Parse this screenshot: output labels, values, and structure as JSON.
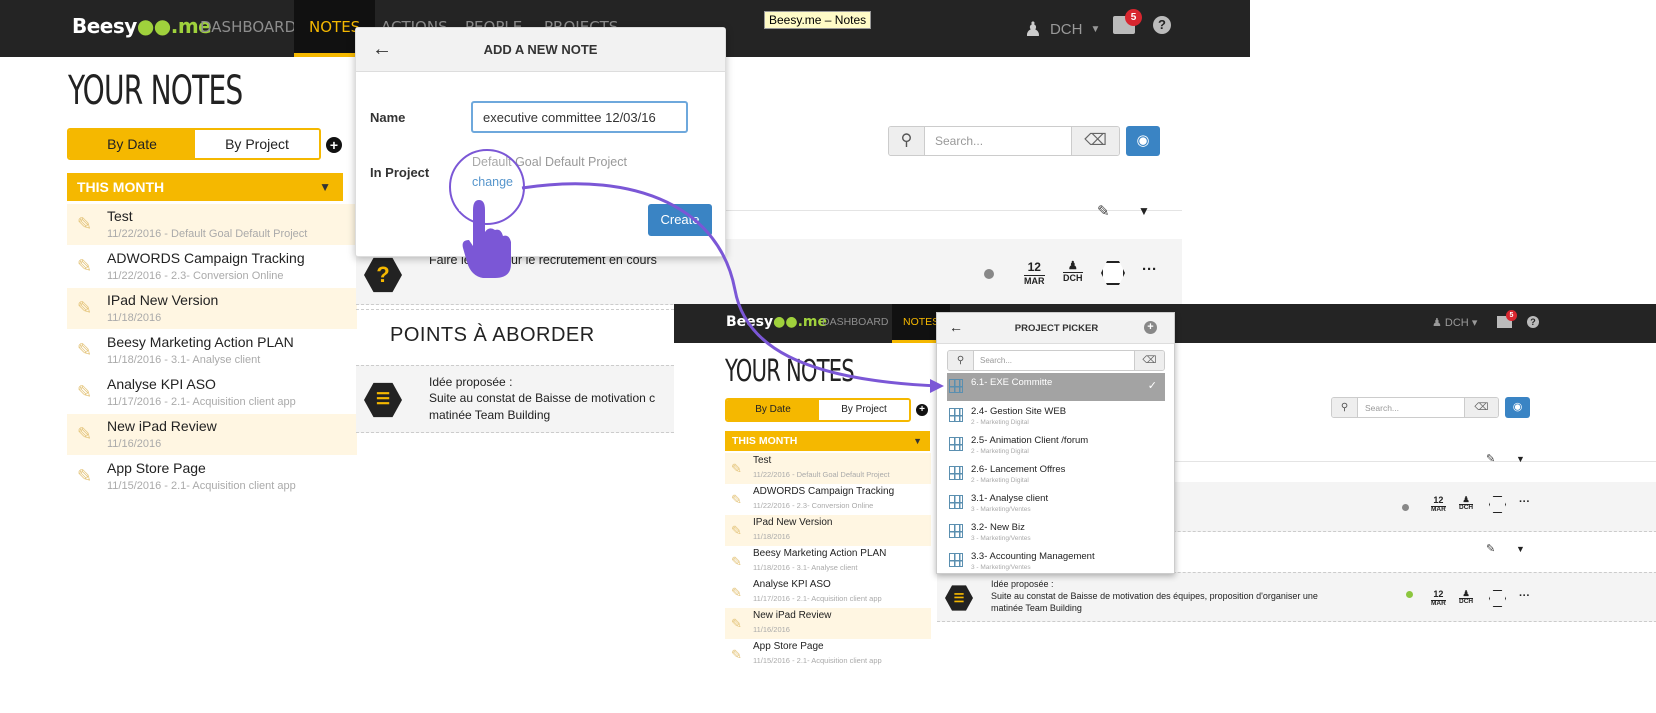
{
  "tooltip": "Beesy.me – Notes",
  "nav": {
    "logo_a": "Beesy",
    "logo_dots": "●●",
    "logo_b": ".me",
    "items": [
      "DASHBOARD",
      "NOTES",
      "ACTIONS",
      "PEOPLE",
      "PROJECTS"
    ],
    "user": "DCH",
    "badge": "5"
  },
  "page_title": "YOUR NOTES",
  "tabs": {
    "by_date": "By Date",
    "by_project": "By Project"
  },
  "month_label": "THIS MONTH",
  "notes": [
    {
      "title": "Test",
      "sub": "11/22/2016  -  Default Goal Default Project"
    },
    {
      "title": "ADWORDS Campaign Tracking",
      "sub": "11/22/2016  -  2.3- Conversion Online"
    },
    {
      "title": "IPad New Version",
      "sub": "11/18/2016"
    },
    {
      "title": "Beesy Marketing Action PLAN",
      "sub": "11/18/2016  -  3.1- Analyse client"
    },
    {
      "title": "Analyse KPI ASO",
      "sub": "11/17/2016  -  2.1- Acquisition client app"
    },
    {
      "title": "New iPad Review",
      "sub": "11/16/2016"
    },
    {
      "title": "App Store Page",
      "sub": "11/15/2016  -  2.1- Acquisition client app"
    }
  ],
  "search_placeholder": "Search...",
  "modal": {
    "title": "ADD A NEW NOTE",
    "name_label": "Name",
    "name_value": "executive committee 12/03/16",
    "project_label": "In Project",
    "project_value": "Default Goal Default Project",
    "change_link": "change",
    "create_button": "Create"
  },
  "row1": {
    "text": "Faire le point sur le recrutement en cours",
    "day": "12",
    "month": "MAR",
    "owner": "DCH",
    "icon": "?"
  },
  "section_title": "POINTS À ABORDER",
  "row2": {
    "label": "Idée proposée :",
    "text": "Suite au constat de Baisse de motivation des équipes, proposition d'organiser une matinée Team Building",
    "text_cut": "Suite au constat de Baisse de motivation c",
    "text_line2": "matinée Team Building"
  },
  "picker": {
    "title": "PROJECT PICKER",
    "search_placeholder": "Search...",
    "items": [
      {
        "title": "6.1- EXE Committe",
        "sub": "",
        "selected": true
      },
      {
        "title": "2.4- Gestion Site WEB",
        "sub": "2 - Marketing Digital"
      },
      {
        "title": "2.5- Animation Client /forum",
        "sub": "2 - Marketing Digital"
      },
      {
        "title": "2.6- Lancement Offres",
        "sub": "2 - Marketing Digital"
      },
      {
        "title": "3.1- Analyse client",
        "sub": "3 - Marketing/Ventes"
      },
      {
        "title": "3.2- New Biz",
        "sub": "3 - Marketing/Ventes"
      },
      {
        "title": "3.3- Accounting Management",
        "sub": "3 - Marketing/Ventes"
      }
    ]
  },
  "shot2": {
    "nav_items": [
      "DASHBOARD",
      "NOTES"
    ],
    "row2_text_a": "Suite au constat de Baisse de motivation des équipes, proposition d'organiser une",
    "row2_text_b": "matinée Team Building"
  },
  "colors": {
    "accent": "#f5b800",
    "primary": "#3a84c4",
    "nav_bg": "#242424",
    "arrow": "#7b57d6"
  }
}
